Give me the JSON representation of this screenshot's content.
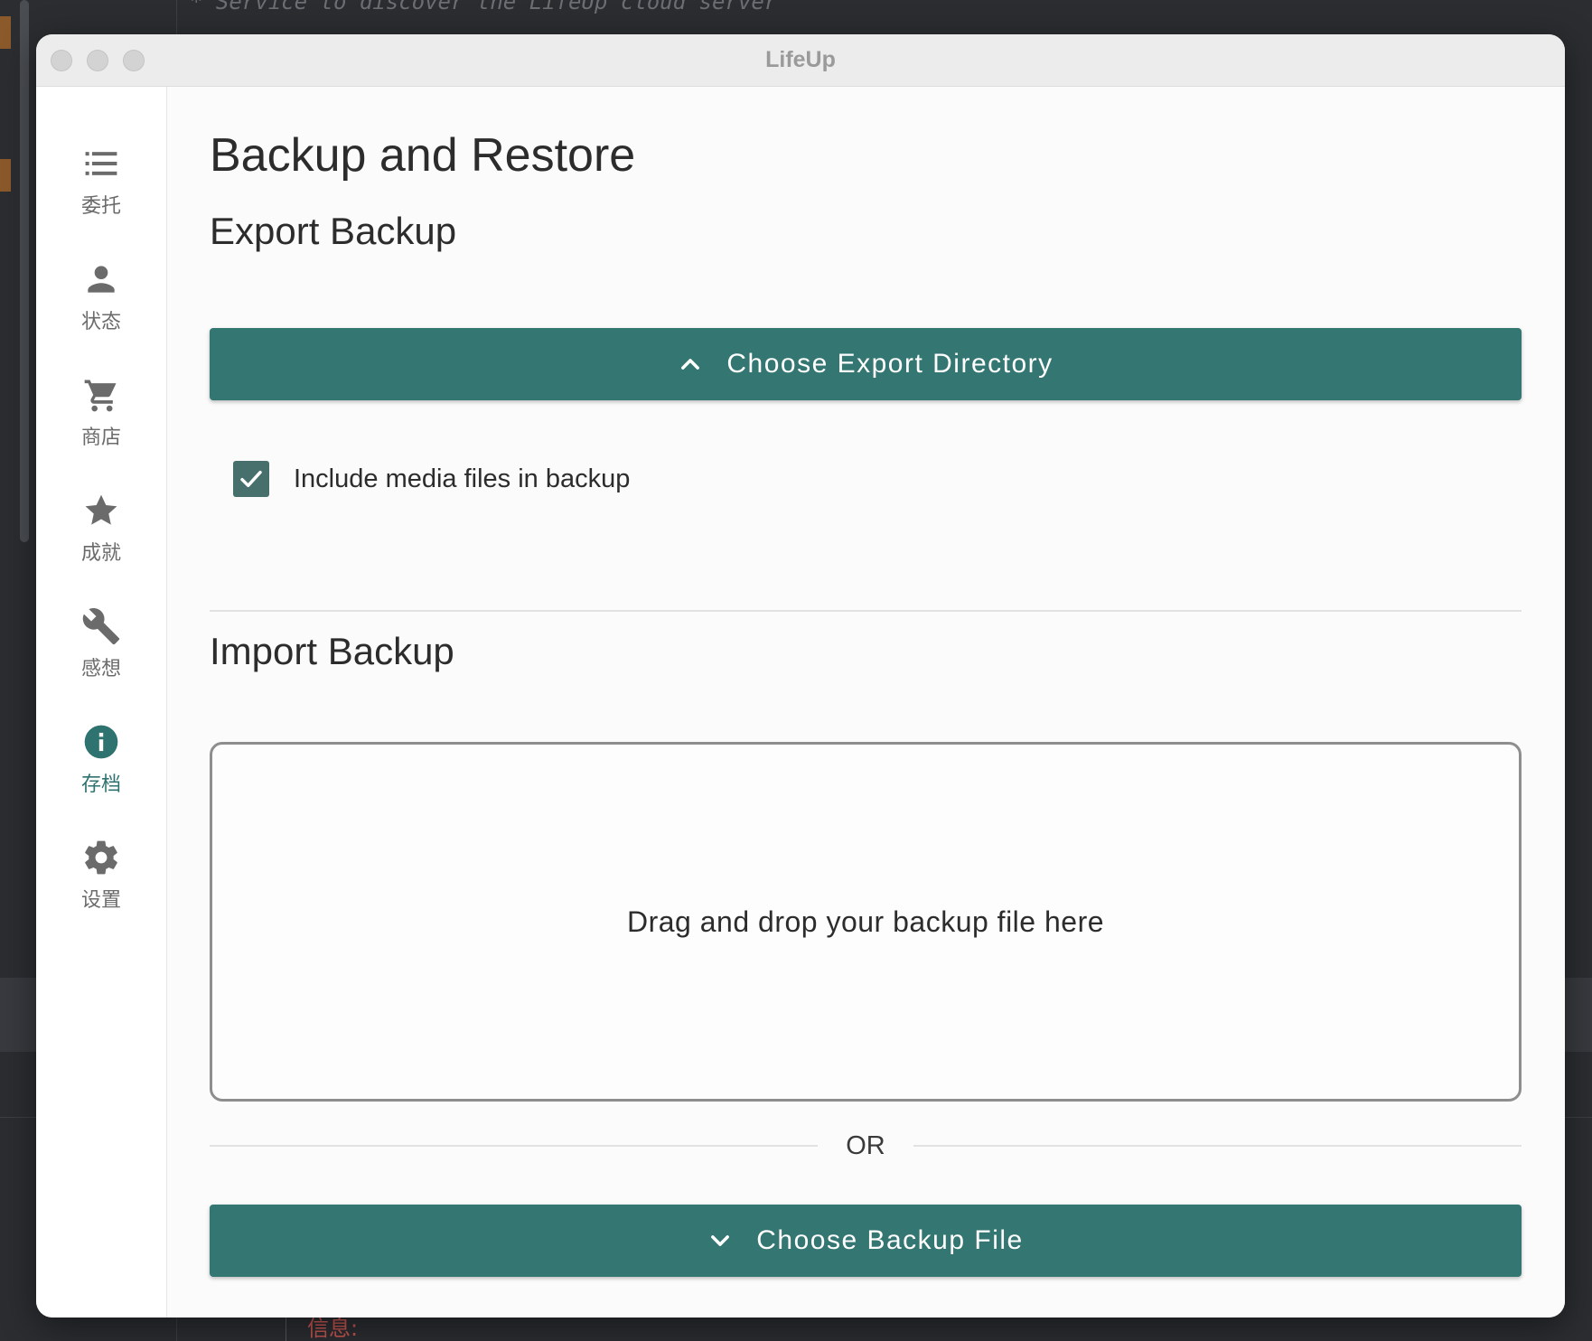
{
  "background": {
    "code_line": "* Service to discover the LifeUp cloud server",
    "bottom_text": "信息:"
  },
  "window": {
    "title": "LifeUp"
  },
  "sidebar": {
    "items": [
      {
        "label": "委托",
        "icon": "list-icon",
        "active": false
      },
      {
        "label": "状态",
        "icon": "person-icon",
        "active": false
      },
      {
        "label": "商店",
        "icon": "cart-icon",
        "active": false
      },
      {
        "label": "成就",
        "icon": "star-icon",
        "active": false
      },
      {
        "label": "感想",
        "icon": "wrench-icon",
        "active": false
      },
      {
        "label": "存档",
        "icon": "info-icon",
        "active": true
      },
      {
        "label": "设置",
        "icon": "gear-icon",
        "active": false
      }
    ]
  },
  "main": {
    "title": "Backup and Restore",
    "export": {
      "heading": "Export Backup",
      "button_label": "Choose Export Directory",
      "button_icon": "chevron-up-icon",
      "checkbox_label": "Include media files in backup",
      "checkbox_checked": true
    },
    "import": {
      "heading": "Import Backup",
      "dropzone_text": "Drag and drop your backup file here",
      "separator_text": "OR",
      "button_label": "Choose Backup File",
      "button_icon": "chevron-down-icon"
    }
  },
  "colors": {
    "accent": "#337672",
    "active_nav": "#2f7370",
    "inactive_nav": "#6b6b6b",
    "checkbox": "#47706d"
  }
}
